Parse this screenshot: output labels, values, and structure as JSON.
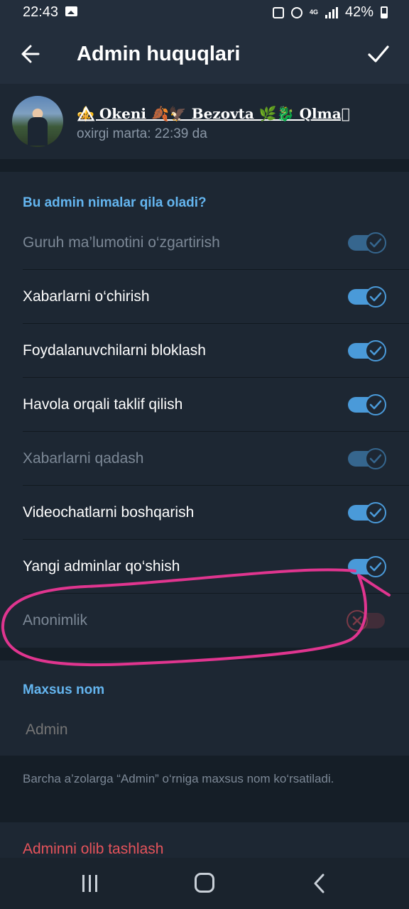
{
  "status_bar": {
    "time": "22:43",
    "network": "4G",
    "battery": "42%"
  },
  "appbar": {
    "title": "Admin huquqlari"
  },
  "profile": {
    "name": "⚜️⃤ Okeni 🍂🦅 Bezovta 🌿🐉 Qlma⃤",
    "status": "oxirgi marta: 22:39 da"
  },
  "permissions": {
    "header": "Bu admin nimalar qila oladi?",
    "items": [
      {
        "label": "Guruh ma’lumotini o‘zgartirish",
        "enabled": true,
        "disabled": true
      },
      {
        "label": "Xabarlarni o‘chirish",
        "enabled": true,
        "disabled": false
      },
      {
        "label": "Foydalanuvchilarni bloklash",
        "enabled": true,
        "disabled": false
      },
      {
        "label": "Havola orqali taklif qilish",
        "enabled": true,
        "disabled": false
      },
      {
        "label": "Xabarlarni qadash",
        "enabled": true,
        "disabled": true
      },
      {
        "label": "Videochatlarni boshqarish",
        "enabled": true,
        "disabled": false
      },
      {
        "label": "Yangi adminlar qo‘shish",
        "enabled": true,
        "disabled": false
      },
      {
        "label": "Anonimlik",
        "enabled": false,
        "disabled": true
      }
    ]
  },
  "custom_title": {
    "header": "Maxsus nom",
    "value": "Admin",
    "hint": "Barcha a’zolarga “Admin” o‘rniga maxsus nom ko‘rsatiladi."
  },
  "actions": {
    "remove_admin": "Adminni olib tashlash"
  },
  "colors": {
    "accent": "#64b5ef",
    "toggle_on": "#4a9ad9",
    "danger": "#e5535b",
    "annotation": "#e0358f"
  }
}
